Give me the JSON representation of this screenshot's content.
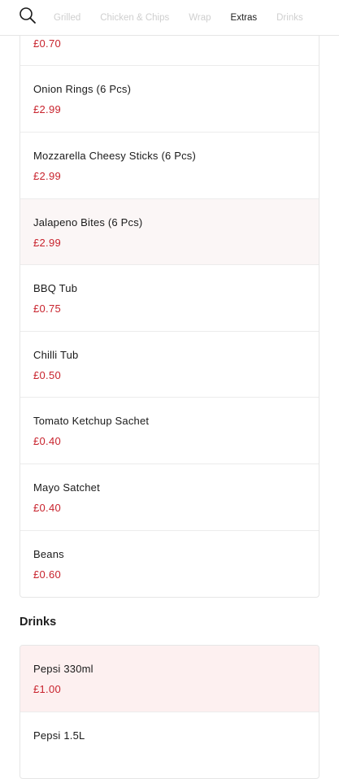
{
  "nav": {
    "tabs": [
      {
        "label": "Grilled"
      },
      {
        "label": "Chicken & Chips"
      },
      {
        "label": "Wrap"
      },
      {
        "label": "Extras"
      },
      {
        "label": "Drinks"
      }
    ],
    "active_tab": "Extras"
  },
  "extras": {
    "items": [
      {
        "name": "",
        "price": "£0.70"
      },
      {
        "name": "Onion Rings (6 Pcs)",
        "price": "£2.99"
      },
      {
        "name": "Mozzarella Cheesy Sticks (6 Pcs)",
        "price": "£2.99"
      },
      {
        "name": "Jalapeno Bites (6 Pcs)",
        "price": "£2.99"
      },
      {
        "name": "BBQ Tub",
        "price": "£0.75"
      },
      {
        "name": "Chilli Tub",
        "price": "£0.50"
      },
      {
        "name": "Tomato Ketchup Sachet",
        "price": "£0.40"
      },
      {
        "name": "Mayo Satchet",
        "price": "£0.40"
      },
      {
        "name": "Beans",
        "price": "£0.60"
      }
    ]
  },
  "drinks": {
    "title": "Drinks",
    "items": [
      {
        "name": "Pepsi 330ml",
        "price": "£1.00"
      },
      {
        "name": "Pepsi 1.5L",
        "price": ""
      }
    ]
  },
  "colors": {
    "price": "#c8232d",
    "highlight_bg": "#fdf0f0",
    "border": "#e6e6e6"
  }
}
